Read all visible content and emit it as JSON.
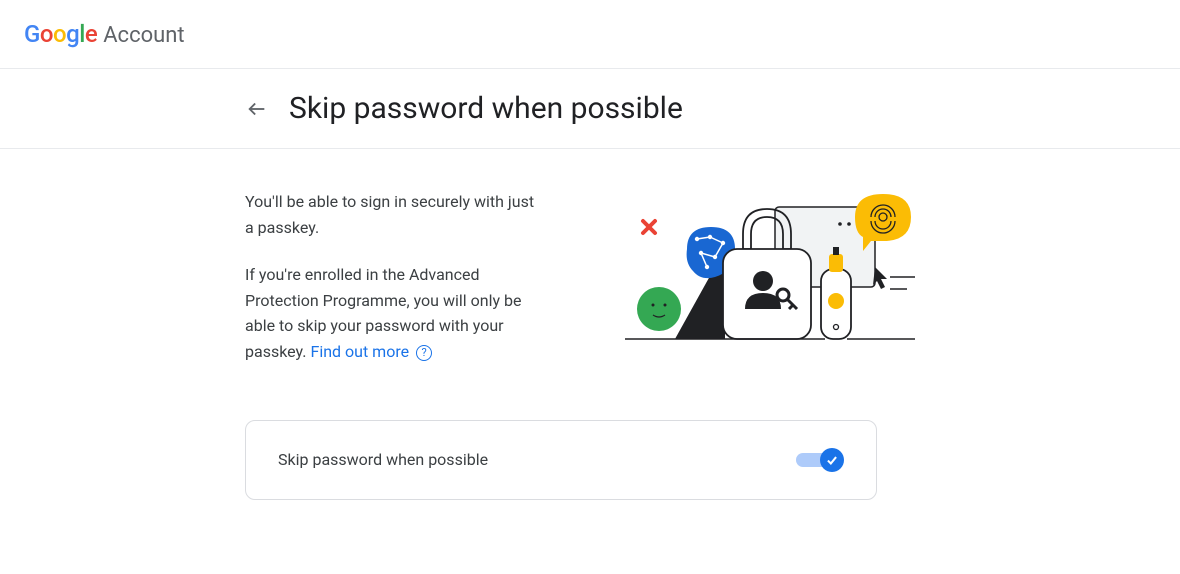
{
  "header": {
    "logo_brand": "Google",
    "logo_product": "Account"
  },
  "page": {
    "title": "Skip password when possible",
    "desc1": "You'll be able to sign in securely with just a passkey.",
    "desc2_prefix": "If you're enrolled in the Advanced Protection Programme, you will only be able to skip your password with your passkey. ",
    "learn_more": "Find out more"
  },
  "setting": {
    "label": "Skip password when possible",
    "enabled": true
  }
}
